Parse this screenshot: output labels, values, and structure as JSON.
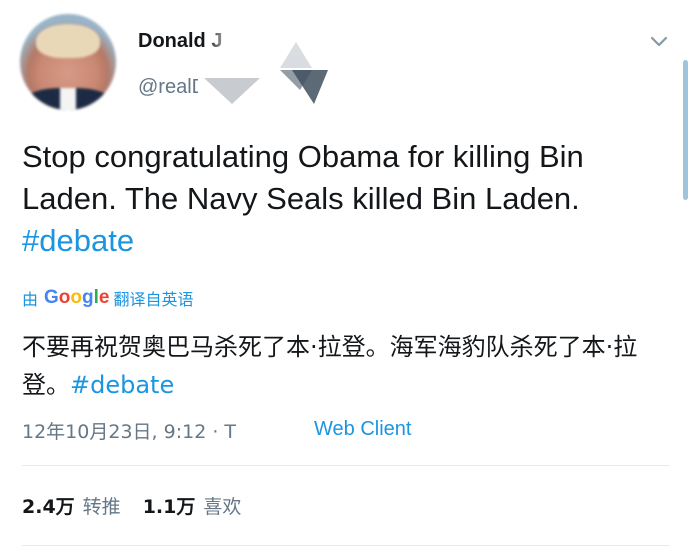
{
  "user": {
    "display_name": "Donald J",
    "handle": "@realD"
  },
  "tweet": {
    "text_before_hashtag": "Stop congratulating Obama for killing Bin Laden. The Navy Seals killed Bin Laden. ",
    "hashtag": "#debate"
  },
  "translation": {
    "by": "由",
    "provider": "Google",
    "action": "翻译自英语",
    "text_before_hashtag": "不要再祝贺奥巴马杀死了本·拉登。海军海豹队杀死了本·拉登。",
    "hashtag": "#debate"
  },
  "meta": {
    "timestamp": "12年10月23日, 9:12 · T",
    "client": "Web Client"
  },
  "stats": {
    "retweets_count": "2.4万",
    "retweets_label": "转推",
    "likes_count": "1.1万",
    "likes_label": "喜欢"
  },
  "colors": {
    "hashtag": "#1b95e0",
    "secondary_text": "#657786",
    "primary_text": "#14171a",
    "divider": "#e6ecf0",
    "google_blue": "#4285f4",
    "google_red": "#ea4335",
    "google_yellow": "#fbbc05",
    "google_green": "#34a853"
  },
  "icons": {
    "menu": "chevron-down-icon"
  }
}
